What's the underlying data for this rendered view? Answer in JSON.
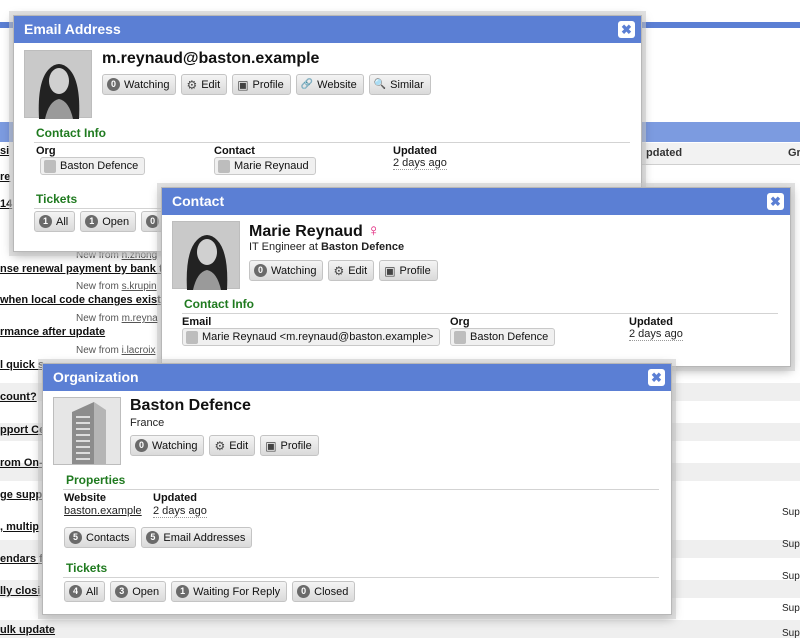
{
  "background": {
    "col_updated": "pdated",
    "col_group": "Gr",
    "rows": [
      {
        "subject": "si",
        "newfrom": "",
        "user": ""
      },
      {
        "subject": "re",
        "newfrom": "",
        "user": ""
      },
      {
        "subject": "14",
        "newfrom": "",
        "user": ""
      },
      {
        "subject": "",
        "newfrom": "New from",
        "user": "n.zhong"
      },
      {
        "subject": "nse renewal payment by bank t",
        "newfrom": "New from",
        "user": "s.krupin"
      },
      {
        "subject": "when local code changes exist",
        "newfrom": "New from",
        "user": "m.reyna"
      },
      {
        "subject": "rmance after update",
        "newfrom": "New from",
        "user": "i.lacroix"
      },
      {
        "subject": "l quick s",
        "newfrom": "",
        "user": ""
      },
      {
        "subject": "count?",
        "newfrom": "",
        "user": ""
      },
      {
        "subject": "pport Ce",
        "newfrom": "",
        "user": ""
      },
      {
        "subject": "rom On-",
        "newfrom": "",
        "user": ""
      },
      {
        "subject": "ge supp",
        "newfrom": "",
        "user": ""
      },
      {
        "subject": ", multip",
        "newfrom": "",
        "user": ""
      },
      {
        "subject": "endars f",
        "newfrom": "",
        "user": ""
      },
      {
        "subject": "lly closi",
        "newfrom": "",
        "user": ""
      },
      {
        "subject": "ulk update",
        "newfrom": "",
        "user": ""
      }
    ],
    "sup": [
      "Sup",
      "Sup",
      "Sup",
      "Sup",
      "Sup"
    ]
  },
  "email_dialog": {
    "title": "Email Address",
    "close_glyph": "✖",
    "email": "m.reynaud@baston.example",
    "buttons": [
      {
        "count": "0",
        "label": "Watching"
      },
      {
        "icon": "⚙",
        "label": "Edit"
      },
      {
        "icon": "▣",
        "label": "Profile"
      },
      {
        "icon": "🔗",
        "label": "Website"
      },
      {
        "icon": "🔍",
        "label": "Similar"
      }
    ],
    "contact_info_title": "Contact Info",
    "org_label": "Org",
    "org_value": "Baston Defence",
    "contact_label": "Contact",
    "contact_value": "Marie Reynaud",
    "updated_label": "Updated",
    "updated_value": "2 days ago",
    "tickets_title": "Tickets",
    "ticket_buttons": [
      {
        "count": "1",
        "label": "All"
      },
      {
        "count": "1",
        "label": "Open"
      },
      {
        "count": "0",
        "label": ""
      }
    ]
  },
  "contact_dialog": {
    "title": "Contact",
    "close_glyph": "✖",
    "name": "Marie Reynaud",
    "gender_glyph": "♀",
    "role_prefix": "IT Engineer at",
    "org": "Baston Defence",
    "buttons": [
      {
        "count": "0",
        "label": "Watching"
      },
      {
        "icon": "⚙",
        "label": "Edit"
      },
      {
        "icon": "▣",
        "label": "Profile"
      }
    ],
    "contact_info_title": "Contact Info",
    "email_label": "Email",
    "email_value": "Marie Reynaud <m.reynaud@baston.example>",
    "org_label": "Org",
    "org_value": "Baston Defence",
    "updated_label": "Updated",
    "updated_value": "2 days ago"
  },
  "org_dialog": {
    "title": "Organization",
    "close_glyph": "✖",
    "name": "Baston Defence",
    "country": "France",
    "buttons": [
      {
        "count": "0",
        "label": "Watching"
      },
      {
        "icon": "⚙",
        "label": "Edit"
      },
      {
        "icon": "▣",
        "label": "Profile"
      }
    ],
    "properties_title": "Properties",
    "website_label": "Website",
    "website_value": "baston.example",
    "updated_label": "Updated",
    "updated_value": "2 days ago",
    "related_buttons": [
      {
        "count": "5",
        "label": "Contacts"
      },
      {
        "count": "5",
        "label": "Email Addresses"
      }
    ],
    "tickets_title": "Tickets",
    "ticket_buttons": [
      {
        "count": "4",
        "label": "All"
      },
      {
        "count": "3",
        "label": "Open"
      },
      {
        "count": "1",
        "label": "Waiting For Reply"
      },
      {
        "count": "0",
        "label": "Closed"
      }
    ]
  },
  "colors": {
    "titlebar": "#5b7fd4",
    "section": "#1f7a1f",
    "female": "#e0207a"
  }
}
